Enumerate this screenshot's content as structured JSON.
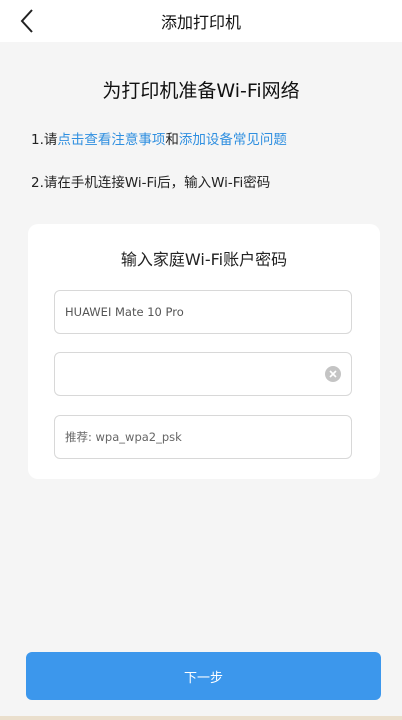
{
  "header": {
    "title": "添加打印机",
    "back_icon": "chevron-left-icon"
  },
  "main": {
    "heading": "为打印机准备Wi-Fi网络",
    "steps": [
      {
        "prefix": "1.请",
        "link1": "点击查看注意事项",
        "connector": "和",
        "link2": "添加设备常见问题"
      },
      {
        "text": "2.请在手机连接Wi-Fi后，输入Wi-Fi密码"
      }
    ]
  },
  "card": {
    "title": "输入家庭Wi-Fi账户密码",
    "ssid_value": "HUAWEI Mate 10 Pro",
    "password_value": "",
    "clear_icon": "clear-circle-icon",
    "hint": "推荐: wpa_wpa2_psk"
  },
  "footer": {
    "next_label": "下一步"
  },
  "colors": {
    "link": "#2f8fe0",
    "primary_button": "#3c97ec",
    "background": "#f5f5f5"
  }
}
